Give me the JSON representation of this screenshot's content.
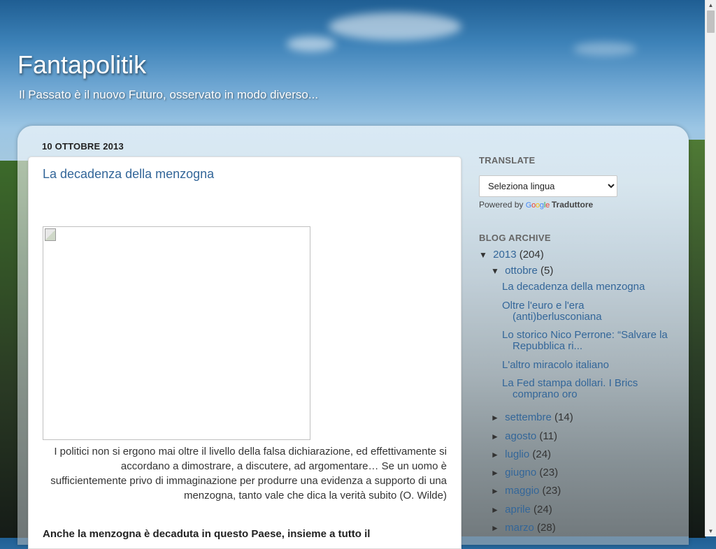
{
  "header": {
    "title": "Fantapolitik",
    "description": "Il Passato è il nuovo Futuro, osservato in modo diverso..."
  },
  "post": {
    "date": "10 OTTOBRE 2013",
    "title": "La decadenza della menzogna",
    "quote": "I politici non si ergono mai oltre il livello della falsa  dichiarazione, ed effettivamente si accordano a dimostrare, a discutere, ad argomentare… Se un uomo è sufficientemente privo di immaginazione per produrre una evidenza a supporto di una menzogna, tanto vale che dica la verità subito (O. Wilde)",
    "lead": "Anche la menzogna è decaduta in questo Paese, insieme a tutto il"
  },
  "sidebar": {
    "translate": {
      "title": "TRANSLATE",
      "select_value": "Seleziona lingua",
      "powered_by": "Powered by",
      "google": "Google",
      "traduttore": "Traduttore"
    },
    "archive": {
      "title": "BLOG ARCHIVE",
      "expanded_toggle": "▼",
      "collapsed_toggle": "►",
      "year": {
        "label": "2013",
        "count": "(204)"
      },
      "month_open": {
        "label": "ottobre",
        "count": "(5)"
      },
      "posts": [
        "La decadenza della menzogna",
        "Oltre l'euro e l'era (anti)berlusconiana",
        "Lo storico Nico Perrone: “Salvare la Repubblica ri...",
        "L'altro miracolo italiano",
        "La Fed stampa dollari. I Brics comprano oro"
      ],
      "months": [
        {
          "label": "settembre",
          "count": "(14)"
        },
        {
          "label": "agosto",
          "count": "(11)"
        },
        {
          "label": "luglio",
          "count": "(24)"
        },
        {
          "label": "giugno",
          "count": "(23)"
        },
        {
          "label": "maggio",
          "count": "(23)"
        },
        {
          "label": "aprile",
          "count": "(24)"
        },
        {
          "label": "marzo",
          "count": "(28)"
        }
      ]
    }
  },
  "scrollbar": {
    "up_icon": "▲",
    "down_icon": "▼"
  }
}
